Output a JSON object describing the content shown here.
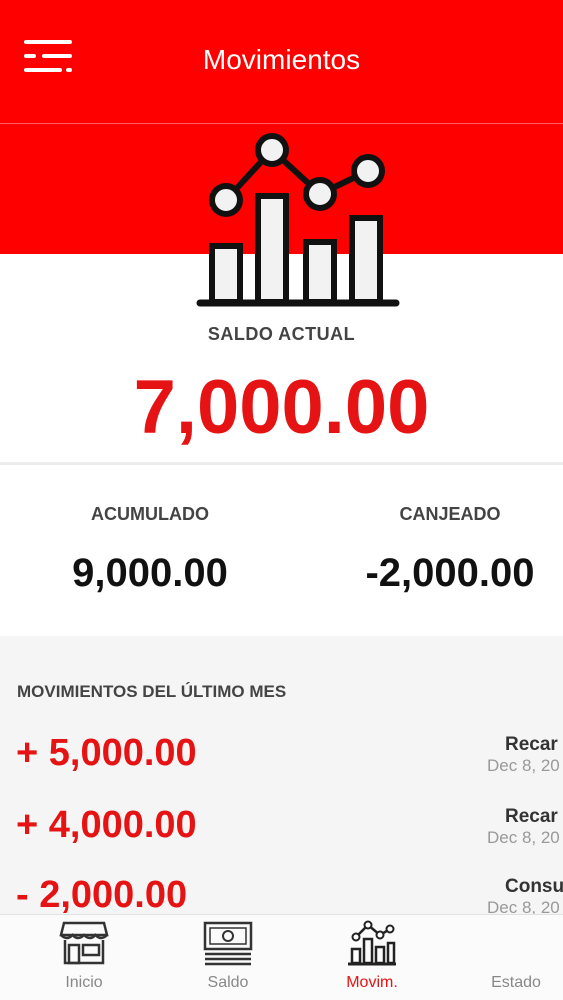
{
  "header": {
    "title": "Movimientos"
  },
  "balance": {
    "label": "SALDO ACTUAL",
    "value": "7,000.00"
  },
  "stats": {
    "acumulado": {
      "label": "ACUMULADO",
      "value": "9,000.00"
    },
    "canjeado": {
      "label": "CANJEADO",
      "value": "-2,000.00"
    }
  },
  "movements": {
    "title": "MOVIMIENTOS DEL ÚLTIMO MES",
    "items": [
      {
        "amount": "+ 5,000.00",
        "type": "Recar",
        "date": "Dec 8, 20"
      },
      {
        "amount": "+ 4,000.00",
        "type": "Recar",
        "date": "Dec 8, 20"
      },
      {
        "amount": "- 2,000.00",
        "type": "Consu",
        "date": "Dec 8, 20"
      }
    ]
  },
  "nav": [
    {
      "label": "Inicio",
      "icon": "store-icon"
    },
    {
      "label": "Saldo",
      "icon": "cash-icon"
    },
    {
      "label": "Movim.",
      "icon": "chart-icon"
    },
    {
      "label": "Estado",
      "icon": "status-icon"
    }
  ],
  "colors": {
    "brand": "#ff0000",
    "accent": "#e51313",
    "background": "#ffffff",
    "panel": "#f5f5f5"
  }
}
